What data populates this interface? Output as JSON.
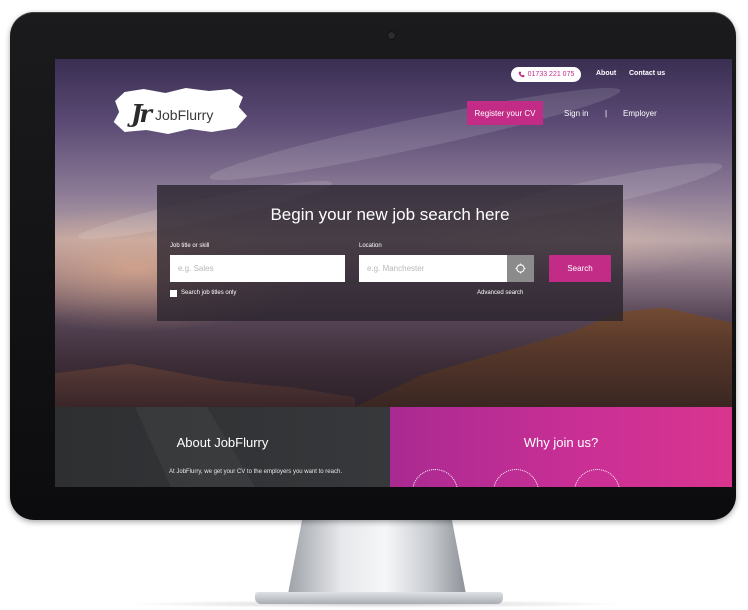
{
  "header": {
    "logo_mark": "Jr",
    "logo_text": "JobFlurry",
    "phone": "01733 221 075",
    "about_link": "About",
    "contact_link": "Contact us",
    "register_label": "Register your CV",
    "signin_label": "Sign in",
    "separator": "|",
    "employer_label": "Employer"
  },
  "search": {
    "title": "Begin your new job search here",
    "job_label": "Job title or skill",
    "job_placeholder": "e.g. Sales",
    "location_label": "Location",
    "location_placeholder": "e.g. Manchester",
    "search_button": "Search",
    "titles_only_label": "Search job titles only",
    "advanced_link": "Advanced search"
  },
  "about": {
    "title": "About JobFlurry",
    "text": "At JobFlurry, we get your CV to the employers you want to reach."
  },
  "why": {
    "title": "Why join us?"
  },
  "colors": {
    "brand": "#c22c87",
    "dark_panel": "#333437",
    "magenta_panel": "#c92f95"
  },
  "icons": {
    "phone": "phone-icon",
    "locate": "locate-icon",
    "camera": "camera-dot"
  }
}
